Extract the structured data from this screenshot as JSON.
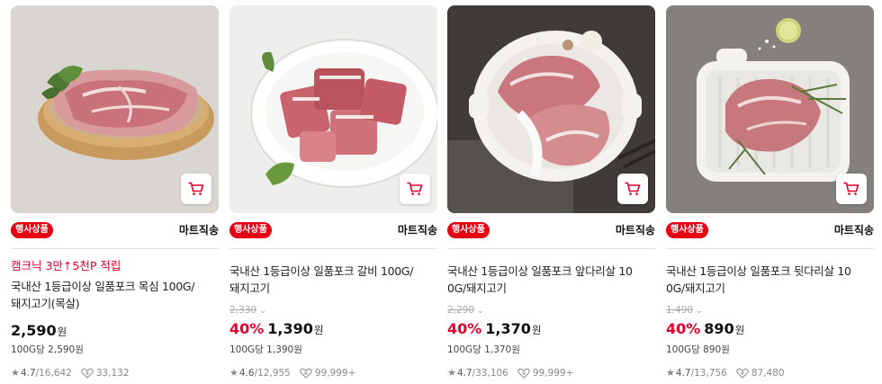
{
  "colors": {
    "accent": "#e4002b",
    "badge": "#e60012"
  },
  "products": [
    {
      "image_icon": "pork-neck-photo",
      "badge": "행사상품",
      "store": "마트직송",
      "promo": "캠크닉 3만↑5천P 적립",
      "name_line1": "국내산 1등급이상 일품포크 목심 100G/",
      "name_line2": "돼지고기(목살)",
      "original_price": "",
      "discount": "",
      "price": "2,590",
      "currency": "원",
      "unit_price": "100G당 2,590원",
      "rating": "4.7",
      "reviews": "/16,642",
      "likes": "33,132"
    },
    {
      "image_icon": "pork-ribs-photo",
      "badge": "행사상품",
      "store": "마트직송",
      "promo": "",
      "name_line1": "국내산 1등급이상 일품포크 갈비 100G/",
      "name_line2": "돼지고기",
      "original_price": "2,330",
      "discount": "40%",
      "price": "1,390",
      "currency": "원",
      "unit_price": "100G당 1,390원",
      "rating": "4.6",
      "reviews": "/12,955",
      "likes": "99,999+"
    },
    {
      "image_icon": "pork-foreleg-photo",
      "badge": "행사상품",
      "store": "마트직송",
      "promo": "",
      "name_line1": "국내산 1등급이상 일품포크 앞다리살 10",
      "name_line2": "0G/돼지고기",
      "original_price": "2,290",
      "discount": "40%",
      "price": "1,370",
      "currency": "원",
      "unit_price": "100G당 1,370원",
      "rating": "4.7",
      "reviews": "/33,106",
      "likes": "99,999+"
    },
    {
      "image_icon": "pork-hindleg-photo",
      "badge": "행사상품",
      "store": "마트직송",
      "promo": "",
      "name_line1": "국내산 1등급이상 일품포크 뒷다리살 10",
      "name_line2": "0G/돼지고기",
      "original_price": "1,490",
      "discount": "40%",
      "price": "890",
      "currency": "원",
      "unit_price": "100G당 890원",
      "rating": "4.7",
      "reviews": "/13,756",
      "likes": "87,480"
    }
  ]
}
